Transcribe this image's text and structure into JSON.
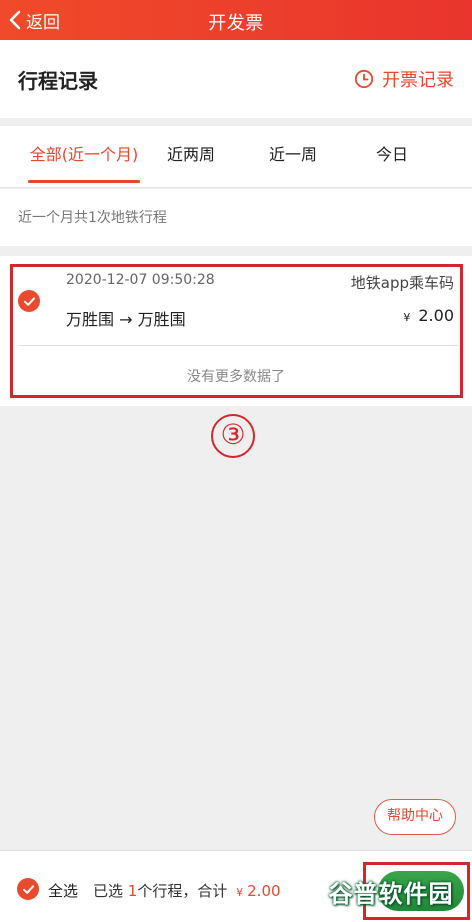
{
  "topbar": {
    "back_label": "返回",
    "title": "开发票"
  },
  "header": {
    "title": "行程记录",
    "invoice_record_label": "开票记录"
  },
  "tabs": [
    {
      "label": "全部(近一个月)",
      "active": true
    },
    {
      "label": "近两周",
      "active": false
    },
    {
      "label": "近一周",
      "active": false
    },
    {
      "label": "今日",
      "active": false
    }
  ],
  "summary": "近一个月共1次地铁行程",
  "trip": {
    "time": "2020-12-07 09:50:28",
    "source": "地铁app乘车码",
    "route": "万胜围 → 万胜围",
    "currency": "¥",
    "amount": "2.00",
    "selected": true
  },
  "list_end": "没有更多数据了",
  "annotation": {
    "step_marker": "③"
  },
  "help_button": "帮助中心",
  "bottom": {
    "select_all": "全选",
    "selected_prefix": "已选",
    "selected_count": "1",
    "selected_suffix": "个行程，合计",
    "currency": "¥",
    "total": "2.00"
  },
  "watermark": "谷普软件园",
  "colors": {
    "accent": "#e9472c",
    "annotation": "#d5262c",
    "primary_button": "#2a9a40"
  }
}
